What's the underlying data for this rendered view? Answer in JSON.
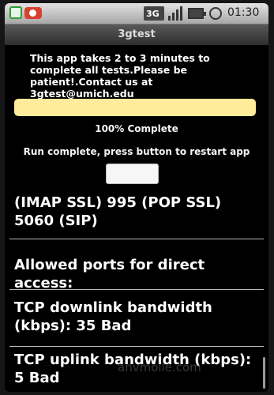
{
  "status_bar": {
    "time": "01:30",
    "network": "3G",
    "icons": [
      "app-notification-icon",
      "alert-notification-icon",
      "3g-data-icon",
      "signal-icon",
      "battery-icon",
      "sync-icon"
    ]
  },
  "app": {
    "title": "3gtest"
  },
  "intro": {
    "text": "This app takes 2 to 3 minutes to complete all tests.Please be patient!.Contact us at 3gtest@umich.edu"
  },
  "progress": {
    "value": 1.0,
    "label": "100% Complete",
    "color": "#ffeb9a"
  },
  "status": {
    "message": "Run complete, press button to restart app"
  },
  "restart_button": {
    "label": ""
  },
  "results": [
    "(IMAP SSL) 995 (POP SSL) 5060 (SIP)",
    "Allowed ports for direct access:",
    "TCP downlink bandwidth (kbps): 35 Bad",
    "TCP uplink bandwidth (kbps): 5 Bad"
  ],
  "watermark": "anvmoile.com"
}
